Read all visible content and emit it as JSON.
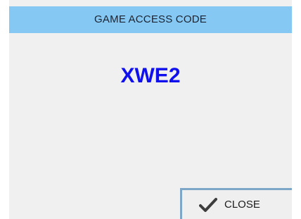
{
  "dialog": {
    "title": "GAME ACCESS CODE",
    "access_code": "XWE2",
    "close_label": "CLOSE",
    "icons": {
      "close": "checkmark-icon"
    },
    "colors": {
      "title_bar": "#85c8f3",
      "code_text": "#1010ee",
      "background": "#f0f0f0"
    }
  }
}
